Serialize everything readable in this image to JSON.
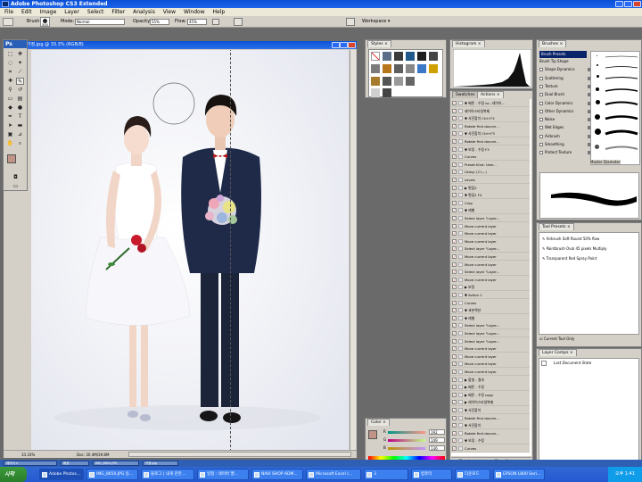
{
  "app_title": "Adobe Photoshop CS3 Extended",
  "menu": [
    "File",
    "Edit",
    "Image",
    "Layer",
    "Select",
    "Filter",
    "Analysis",
    "View",
    "Window",
    "Help"
  ],
  "options": {
    "brush_label": "Brush:",
    "brush_size": "500",
    "mode_label": "Mode:",
    "mode_value": "Normal",
    "opacity_label": "Opacity:",
    "opacity_value": "55%",
    "flow_label": "Flow:",
    "flow_value": "45%",
    "workspace_label": "Workspace ▾"
  },
  "toolbox": {
    "logo": "Ps"
  },
  "document": {
    "title": "가정.jpg @ 33.3% (RGB/8)",
    "zoom": "33.33%",
    "doc_info": "Doc: 20.4M/39.8M"
  },
  "panels": {
    "styles_tab": "Styles",
    "histogram_tab": "Histogram",
    "brushes_tab": "Brushes",
    "swatches_tab": "Swatches",
    "actions_tab": "Actions",
    "tool_presets_tab": "Tool Presets",
    "layer_comps_tab": "Layer Comps",
    "color_tab": "Color",
    "brush_presets_title": "Brush Presets",
    "brush_options": [
      {
        "label": "Brush Tip Shape",
        "checkbox": false
      },
      {
        "label": "Shape Dynamics",
        "checkbox": true
      },
      {
        "label": "Scattering",
        "checkbox": true
      },
      {
        "label": "Texture",
        "checkbox": true
      },
      {
        "label": "Dual Brush",
        "checkbox": true
      },
      {
        "label": "Color Dynamics",
        "checkbox": true
      },
      {
        "label": "Other Dynamics",
        "checkbox": true
      },
      {
        "label": "Noise",
        "checkbox": true
      },
      {
        "label": "Wet Edges",
        "checkbox": true
      },
      {
        "label": "Airbrush",
        "checkbox": true
      },
      {
        "label": "Smoothing",
        "checkbox": true
      },
      {
        "label": "Protect Texture",
        "checkbox": true
      }
    ],
    "master_diameter": "Master Diameter",
    "tool_presets": [
      "Airbrush Soft Round 50% flow",
      "Paintbrush Oval 45 pixels Multiply",
      "Transparent Red Spray Paint"
    ],
    "current_tool_only": "Current Tool Only",
    "layer_comps_state": "Last Document State",
    "color_values": [
      "192",
      "149",
      "136"
    ],
    "color_channels": [
      "R",
      "G",
      "B"
    ]
  },
  "actions": [
    {
      "text": "▼ 베른 - 수정 co...레이어...",
      "check": true
    },
    {
      "text": "레이어스타일복제",
      "check": true
    },
    {
      "text": "▼ 사진합치 Ctrl+F2",
      "check": true
    },
    {
      "text": "Rotate first docum...",
      "check": true
    },
    {
      "text": "▼ 사진합치 Ctrl+F3",
      "check": true
    },
    {
      "text": "Rotate first docum...",
      "check": true
    },
    {
      "text": "▼ 보정 - 수정 F3",
      "check": true
    },
    {
      "text": "Curves",
      "check": true
    },
    {
      "text": "Preset Kind: User...",
      "check": true
    },
    {
      "text": "Using: (C:\\...)",
      "check": true
    },
    {
      "text": "Levels",
      "check": true
    },
    {
      "text": "▶ 편집2",
      "check": true
    },
    {
      "text": "▼ 편집2 F4",
      "check": true
    },
    {
      "text": "Crop",
      "check": true
    },
    {
      "text": "▼ 레벨",
      "check": true
    },
    {
      "text": "Select layer \"Layer...",
      "check": true
    },
    {
      "text": "Move current layer",
      "check": true
    },
    {
      "text": "Move current layer",
      "check": true
    },
    {
      "text": "Move current layer",
      "check": true
    },
    {
      "text": "Select layer \"Layer...",
      "check": true
    },
    {
      "text": "Move current layer",
      "check": true
    },
    {
      "text": "Move current layer",
      "check": true
    },
    {
      "text": "Select layer \"Layer...",
      "check": true
    },
    {
      "text": "Move current layer",
      "check": true
    },
    {
      "text": "▶ 보정",
      "check": true
    },
    {
      "text": "▼ Action 1",
      "check": true
    },
    {
      "text": "Curves",
      "check": true
    },
    {
      "text": "▼ 과본액션",
      "check": true
    },
    {
      "text": "▼ 레벨",
      "check": true
    },
    {
      "text": "Select layer \"Layer...",
      "check": true
    },
    {
      "text": "Select layer \"Layer...",
      "check": true
    },
    {
      "text": "Select layer \"Layer...",
      "check": true
    },
    {
      "text": "Move current layer",
      "check": true
    },
    {
      "text": "Move current layer",
      "check": true
    },
    {
      "text": "Move current layer",
      "check": true
    },
    {
      "text": "Move current layer",
      "check": true
    },
    {
      "text": "▶ 합칠 - 결과",
      "check": true
    },
    {
      "text": "▶ 베른 - 수정",
      "check": true
    },
    {
      "text": "▶ 베른 - 수정 copy",
      "check": true
    },
    {
      "text": "▶ 레이어스타일복제",
      "check": true
    },
    {
      "text": "▼ 사진합치",
      "check": true
    },
    {
      "text": "Rotate first docum...",
      "check": true
    },
    {
      "text": "▼ 사진합치",
      "check": true
    },
    {
      "text": "Rotate first docum...",
      "check": true
    },
    {
      "text": "▼ 보정 - 수정",
      "check": true
    },
    {
      "text": "Curves",
      "check": true
    }
  ],
  "mini_tasks": [
    "레이어 4",
    "배경",
    "IMG_8650.JPG",
    "가정.jpg"
  ],
  "taskbar": {
    "start": "시작",
    "items": [
      "Adobe Photos...",
      "IMG_8650.JPG 등...",
      "블로그 | 내게 관한...",
      "일정 : 네이버 멜...",
      "NAVI SHOP ADM...",
      "Microsoft Excel (...",
      "3",
      "컴퓨터",
      "다운로드",
      "EPSON L800 Seri..."
    ],
    "clock": "오후 1:41"
  },
  "colors": {
    "title_blue": "#1c5fe0",
    "chrome": "#d4d0c8",
    "taskbar": "#245ad0",
    "foreground_swatch": "#c09588",
    "background_swatch": "#ffffff"
  }
}
